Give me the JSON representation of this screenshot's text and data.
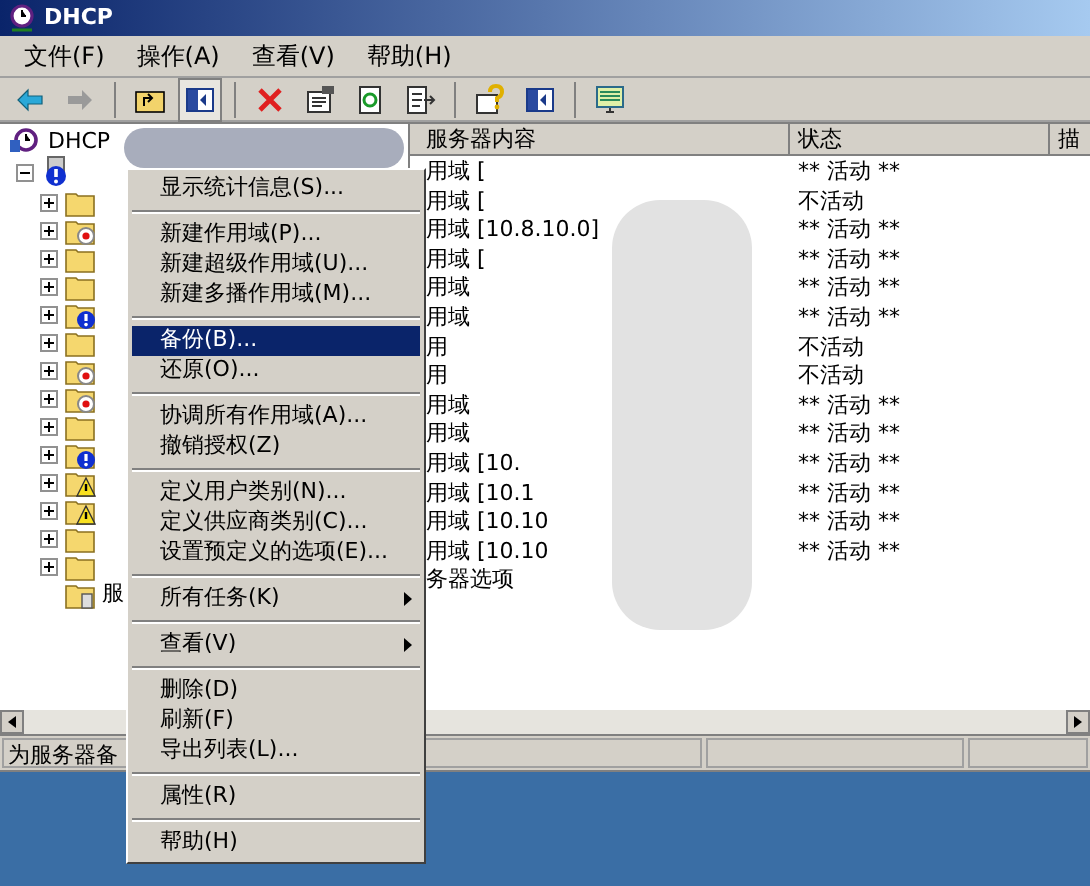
{
  "window": {
    "title": "DHCP"
  },
  "menu_bar": [
    "文件(F)",
    "操作(A)",
    "查看(V)",
    "帮助(H)"
  ],
  "toolbar": [
    {
      "kind": "back"
    },
    {
      "kind": "forward"
    },
    {
      "kind": "sep"
    },
    {
      "kind": "up"
    },
    {
      "kind": "pane",
      "selected": true
    },
    {
      "kind": "sep"
    },
    {
      "kind": "delete"
    },
    {
      "kind": "properties"
    },
    {
      "kind": "refresh"
    },
    {
      "kind": "export"
    },
    {
      "kind": "sep"
    },
    {
      "kind": "help"
    },
    {
      "kind": "pane2"
    },
    {
      "kind": "sep"
    },
    {
      "kind": "monitor"
    }
  ],
  "tree": {
    "label": "DHCP",
    "children": [
      {
        "kind": "server-alert",
        "expanded": true,
        "children": [
          {
            "kind": "folder",
            "expanded": false
          },
          {
            "kind": "folder-error",
            "expanded": false
          },
          {
            "kind": "folder",
            "expanded": false
          },
          {
            "kind": "folder",
            "expanded": false
          },
          {
            "kind": "folder-alert",
            "expanded": false
          },
          {
            "kind": "folder",
            "expanded": false
          },
          {
            "kind": "folder-error",
            "expanded": false
          },
          {
            "kind": "folder-error",
            "expanded": false
          },
          {
            "kind": "folder",
            "expanded": false
          },
          {
            "kind": "folder-alert",
            "expanded": false
          },
          {
            "kind": "folder-warning",
            "expanded": false
          },
          {
            "kind": "folder-warning",
            "expanded": false
          },
          {
            "kind": "folder",
            "expanded": false
          },
          {
            "kind": "folder",
            "expanded": false
          },
          {
            "kind": "options",
            "label": "服"
          }
        ]
      }
    ]
  },
  "table": {
    "columns": [
      "服务器内容",
      "状态",
      "描"
    ],
    "rows": [
      {
        "column_1": "用域 [",
        "status": "** 活动 **"
      },
      {
        "column_1": "用域 [",
        "status": "不活动"
      },
      {
        "column_1": "用域 [10.8.10.0]",
        "status": "** 活动 **"
      },
      {
        "column_1": "用域 [",
        "status": "** 活动 **"
      },
      {
        "column_1": "用域",
        "status": "** 活动 **"
      },
      {
        "column_1": "用域",
        "status": "** 活动 **"
      },
      {
        "column_1": "用",
        "status": "不活动"
      },
      {
        "column_1": "用",
        "status": "不活动"
      },
      {
        "column_1": "用域",
        "status": "** 活动 **"
      },
      {
        "column_1": "用域",
        "status": "** 活动 **"
      },
      {
        "column_1": "用域 [10.",
        "status": "** 活动 **"
      },
      {
        "column_1": "用域 [10.1",
        "status": "** 活动 **"
      },
      {
        "column_1": "用域 [10.10",
        "status": "** 活动 **"
      },
      {
        "column_1": "用域 [10.10",
        "status": "** 活动 **"
      },
      {
        "column_1": "务器选项"
      }
    ]
  },
  "context_menu": {
    "items": [
      {
        "kind": "item",
        "label": "显示统计信息(S)...",
        "selected": false
      },
      {
        "kind": "separator"
      },
      {
        "kind": "item",
        "label": "新建作用域(P)...",
        "selected": false
      },
      {
        "kind": "item",
        "label": "新建超级作用域(U)...",
        "selected": false
      },
      {
        "kind": "item",
        "label": "新建多播作用域(M)...",
        "selected": false
      },
      {
        "kind": "separator"
      },
      {
        "kind": "item",
        "label": "备份(B)...",
        "selected": true
      },
      {
        "kind": "item",
        "label": "还原(O)...",
        "selected": false
      },
      {
        "kind": "separator"
      },
      {
        "kind": "item",
        "label": "协调所有作用域(A)...",
        "selected": false
      },
      {
        "kind": "item",
        "label": "撤销授权(Z)",
        "selected": false
      },
      {
        "kind": "separator"
      },
      {
        "kind": "item",
        "label": "定义用户类别(N)...",
        "selected": false
      },
      {
        "kind": "item",
        "label": "定义供应商类别(C)...",
        "selected": false
      },
      {
        "kind": "item",
        "label": "设置预定义的选项(E)...",
        "selected": false
      },
      {
        "kind": "separator"
      },
      {
        "kind": "submenu",
        "label": "所有任务(K)",
        "selected": false
      },
      {
        "kind": "separator"
      },
      {
        "kind": "submenu",
        "label": "查看(V)",
        "selected": false
      },
      {
        "kind": "separator"
      },
      {
        "kind": "item",
        "label": "删除(D)",
        "selected": false
      },
      {
        "kind": "item",
        "label": "刷新(F)",
        "selected": false
      },
      {
        "kind": "item",
        "label": "导出列表(L)...",
        "selected": false
      },
      {
        "kind": "separator"
      },
      {
        "kind": "item",
        "label": "属性(R)",
        "selected": false
      },
      {
        "kind": "separator"
      },
      {
        "kind": "item",
        "label": "帮助(H)",
        "selected": false
      }
    ]
  },
  "status_bar": {
    "text": "为服务器备"
  }
}
